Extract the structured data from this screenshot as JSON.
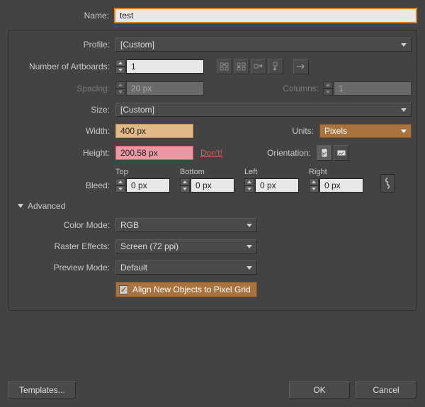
{
  "labels": {
    "name": "Name:",
    "profile": "Profile:",
    "artboards": "Number of Artboards:",
    "spacing": "Spacing:",
    "columns": "Columns:",
    "size": "Size:",
    "width": "Width:",
    "height": "Height:",
    "units": "Units:",
    "orientation": "Orientation:",
    "bleed": "Bleed:",
    "top": "Top",
    "bottom": "Bottom",
    "left": "Left",
    "right": "Right",
    "advanced": "Advanced",
    "color_mode": "Color Mode:",
    "raster": "Raster Effects:",
    "preview": "Preview Mode:"
  },
  "values": {
    "name": "test",
    "profile": "[Custom]",
    "artboards": "1",
    "spacing": "20 px",
    "columns": "1",
    "size": "[Custom]",
    "width": "400 px",
    "height": "200.58 px",
    "units": "Pixels",
    "bleed_top": "0 px",
    "bleed_bottom": "0 px",
    "bleed_left": "0 px",
    "bleed_right": "0 px",
    "color_mode": "RGB",
    "raster": "Screen (72 ppi)",
    "preview": "Default"
  },
  "warnings": {
    "dont": "Don't!"
  },
  "checkbox": {
    "align_grid": "Align New Objects to Pixel Grid",
    "checked": true
  },
  "buttons": {
    "templates": "Templates...",
    "ok": "OK",
    "cancel": "Cancel"
  }
}
